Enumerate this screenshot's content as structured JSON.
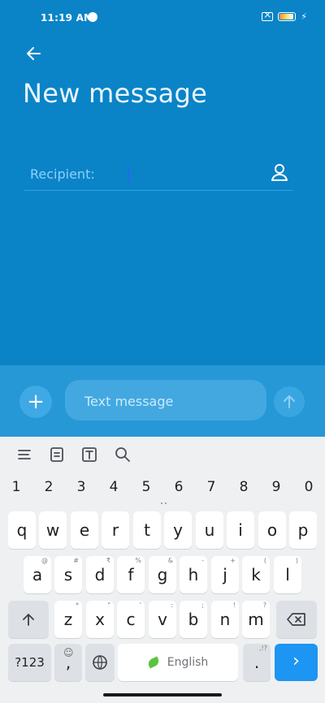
{
  "status_bar": {
    "time": "11:19 AM"
  },
  "header": {
    "title": "New message"
  },
  "recipient": {
    "label": "Recipient:",
    "value": ""
  },
  "compose": {
    "placeholder": "Text message",
    "value": ""
  },
  "keyboard": {
    "number_row": [
      "1",
      "2",
      "3",
      "4",
      "5",
      "6",
      "7",
      "8",
      "9",
      "0"
    ],
    "row1": [
      {
        "key": "q"
      },
      {
        "key": "w"
      },
      {
        "key": "e"
      },
      {
        "key": "r"
      },
      {
        "key": "t"
      },
      {
        "key": "y"
      },
      {
        "key": "u"
      },
      {
        "key": "i"
      },
      {
        "key": "o"
      },
      {
        "key": "p"
      }
    ],
    "row2": [
      {
        "key": "a",
        "hint": "@"
      },
      {
        "key": "s",
        "hint": "#"
      },
      {
        "key": "d",
        "hint": "₹"
      },
      {
        "key": "f",
        "hint": "%"
      },
      {
        "key": "g",
        "hint": "&"
      },
      {
        "key": "h",
        "hint": "-"
      },
      {
        "key": "j",
        "hint": "+"
      },
      {
        "key": "k",
        "hint": "("
      },
      {
        "key": "l",
        "hint": ")"
      }
    ],
    "row3": [
      {
        "key": "z",
        "hint": "*"
      },
      {
        "key": "x",
        "hint": "\""
      },
      {
        "key": "c",
        "hint": "'"
      },
      {
        "key": "v",
        "hint": ":"
      },
      {
        "key": "b",
        "hint": ";"
      },
      {
        "key": "n",
        "hint": "!"
      },
      {
        "key": "m",
        "hint": "?"
      }
    ],
    "row4": {
      "symbols_label": "?123",
      "comma_label": ",",
      "space_label": "English",
      "period_label": ".",
      "period_hint": ",!?"
    }
  },
  "colors": {
    "app_blue": "#0a84c7",
    "keyboard_bg": "#eef0f2",
    "enter_blue": "#1d95f2"
  },
  "icons": [
    "back-arrow-icon",
    "contact-icon",
    "add-icon",
    "send-arrow-icon",
    "menu-lines-icon",
    "clipboard-icon",
    "text-box-icon",
    "search-icon",
    "globe-icon",
    "shift-arrow-icon",
    "backspace-icon",
    "enter-arrow-icon"
  ]
}
